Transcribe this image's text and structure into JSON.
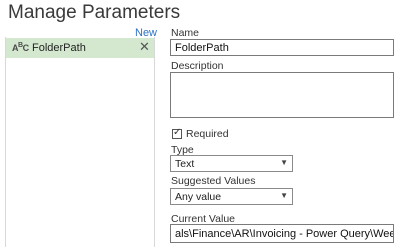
{
  "header": {
    "title": "Manage Parameters",
    "new_label": "New"
  },
  "param_list": {
    "items": [
      {
        "type_icon": "A B C",
        "name": "FolderPath",
        "delete_glyph": "✕"
      }
    ]
  },
  "form": {
    "name_label": "Name",
    "name_value": "FolderPath",
    "description_label": "Description",
    "description_value": "",
    "required_label": "Required",
    "required_checked": true,
    "type_label": "Type",
    "type_value": "Text",
    "suggested_label": "Suggested Values",
    "suggested_value": "Any value",
    "current_value_label": "Current Value",
    "current_value": "als\\Finance\\AR\\Invoicing - Power Query\\Weekly Invoicing\\"
  },
  "colors": {
    "selected_row": "#d4e8d0",
    "link": "#2a72c6"
  }
}
